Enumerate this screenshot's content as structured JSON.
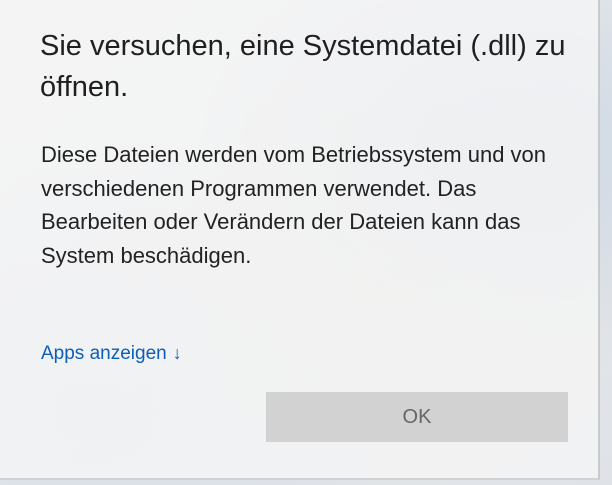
{
  "dialog": {
    "title": "Sie versuchen, eine Systemdatei (.dll) zu öffnen.",
    "message": "Diese Dateien werden vom Betriebssystem und von verschiedenen Programmen verwendet. Das Bearbeiten oder Verändern der Dateien kann das System beschädigen.",
    "apps_link": {
      "label": "Apps anzeigen",
      "icon": "arrow-down-icon",
      "arrow_glyph": "↓",
      "color": "#0b5fb8"
    },
    "ok_button": {
      "label": "OK"
    }
  }
}
